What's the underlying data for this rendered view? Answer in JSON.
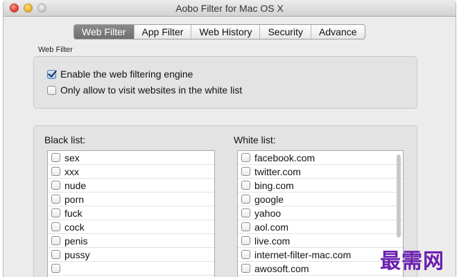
{
  "window": {
    "title": "Aobo Filter for Mac OS X"
  },
  "tabs": [
    {
      "label": "Web Filter",
      "active": true
    },
    {
      "label": "App Filter",
      "active": false
    },
    {
      "label": "Web History",
      "active": false
    },
    {
      "label": "Security",
      "active": false
    },
    {
      "label": "Advance",
      "active": false
    }
  ],
  "web_filter": {
    "section_label": "Web Filter",
    "options": [
      {
        "label": "Enable the web filtering engine",
        "checked": true
      },
      {
        "label": "Only allow to visit websites in the white list",
        "checked": false
      }
    ]
  },
  "black_list": {
    "label": "Black list:",
    "items": [
      {
        "text": "sex",
        "checked": false
      },
      {
        "text": "xxx",
        "checked": false
      },
      {
        "text": "nude",
        "checked": false
      },
      {
        "text": "porn",
        "checked": false
      },
      {
        "text": "fuck",
        "checked": false
      },
      {
        "text": "cock",
        "checked": false
      },
      {
        "text": "penis",
        "checked": false
      },
      {
        "text": "pussy",
        "checked": false
      },
      {
        "text": "",
        "checked": false
      },
      {
        "text": "",
        "checked": false
      }
    ]
  },
  "white_list": {
    "label": "White list:",
    "items": [
      {
        "text": "facebook.com",
        "checked": false
      },
      {
        "text": "twitter.com",
        "checked": false
      },
      {
        "text": "bing.com",
        "checked": false
      },
      {
        "text": "google",
        "checked": false
      },
      {
        "text": "yahoo",
        "checked": false
      },
      {
        "text": "aol.com",
        "checked": false
      },
      {
        "text": "live.com",
        "checked": false
      },
      {
        "text": "internet-filter-mac.com",
        "checked": false
      },
      {
        "text": "awosoft.com",
        "checked": false
      }
    ]
  },
  "watermark": {
    "text": "最需网"
  },
  "icons": {
    "close": "close-traffic-light-icon",
    "minimize": "minimize-traffic-light-icon",
    "zoom": "zoom-traffic-light-icon",
    "checkbox": "checkbox-icon"
  }
}
